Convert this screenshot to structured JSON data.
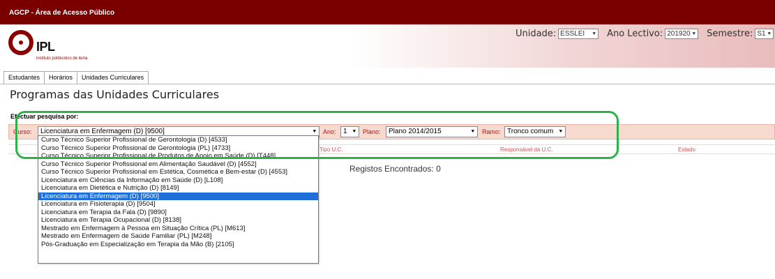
{
  "app": {
    "title": "AGCP - Área de Acesso Público"
  },
  "logo": {
    "name": "IPL",
    "subtitle": "instituto politécnico de leiria"
  },
  "selectors": {
    "unidade_label": "Unidade:",
    "unidade_value": "ESSLEI",
    "ano_lectivo_label": "Ano Lectivo:",
    "ano_lectivo_value": "201920",
    "semestre_label": "Semestre:",
    "semestre_value": "S1"
  },
  "tabs": [
    {
      "label": "Estudantes"
    },
    {
      "label": "Horários"
    },
    {
      "label": "Unidades Curriculares"
    }
  ],
  "page": {
    "title": "Programas das Unidades Curriculares",
    "search_label": "Efectuar pesquisa por:"
  },
  "filters": {
    "curso_label": "Curso:",
    "curso_value": "Licenciatura em Enfermagem (D) [9500]",
    "ano_label": "Ano:",
    "ano_value": "1",
    "plano_label": "Plano:",
    "plano_value": "Plano 2014/2015",
    "ramo_label": "Ramo:",
    "ramo_value": "Tronco comum"
  },
  "table": {
    "columns": [
      "Tipo U.C.",
      "Responsável da U.C.",
      "Estado"
    ]
  },
  "records_text": "Registos Encontrados: 0",
  "curso_options": [
    "Curso Técnico Superior Profissional de Gerontologia (D) [4533]",
    "Curso Técnico Superior Profissional de Gerontologia (PL) [4733]",
    "Curso Técnico Superior Profissional de Produtos de Apoio em Saúde (D) [T448]",
    "Curso Técnico Superior Profissional em Alimentação Saudável (D) [4552]",
    "Curso Técnico Superior Profissional em Estética, Cosmética e Bem-estar (D) [4553]",
    "Licenciatura em Ciências da Informação em Saúde (D) [L108]",
    "Licenciatura em Dietética e Nutrição (D) [8149]",
    "Licenciatura em Enfermagem (D) [9500]",
    "Licenciatura em Fisioterapia (D) [9504]",
    "Licenciatura em Terapia da Fala (D) [9890]",
    "Licenciatura em Terapia Ocupacional (D) [8138]",
    "Mestrado em Enfermagem à Pessoa em Situação Crítica (PL) [M613]",
    "Mestrado em Enfermagem de Saúde Familiar (PL) [M248]",
    "Pós-Graduação em Especialização em Terapia da Mão (B) [2105]"
  ],
  "selected_option_index": 7,
  "colors": {
    "topbar": "#7a0000",
    "highlight": "#2bb24a",
    "selected": "#1e6fd9"
  }
}
